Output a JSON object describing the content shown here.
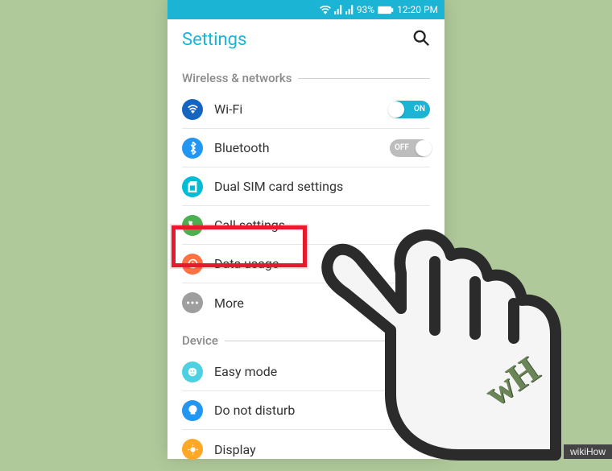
{
  "status": {
    "battery_pct": "93%",
    "time": "12:20 PM"
  },
  "header": {
    "title": "Settings"
  },
  "sections": [
    {
      "title": "Wireless & networks",
      "items": [
        {
          "label": "Wi-Fi",
          "toggle": "ON"
        },
        {
          "label": "Bluetooth",
          "toggle": "OFF"
        },
        {
          "label": "Dual SIM card settings"
        },
        {
          "label": "Call settings"
        },
        {
          "label": "Data usage"
        },
        {
          "label": "More"
        }
      ]
    },
    {
      "title": "Device",
      "items": [
        {
          "label": "Easy mode"
        },
        {
          "label": "Do not disturb"
        },
        {
          "label": "Display"
        }
      ]
    }
  ],
  "annotation": {
    "highlighted_item": "Data usage",
    "source": "wikiHow",
    "logo_text": "wH"
  },
  "colors": {
    "accent": "#1bb4d4",
    "highlight": "#e8192c",
    "bg": "#b0c99a"
  }
}
